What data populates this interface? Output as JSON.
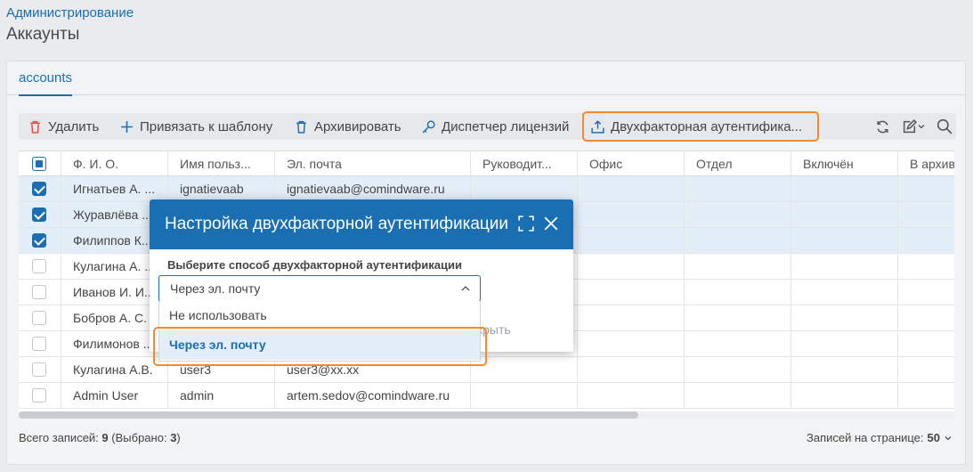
{
  "page": {
    "breadcrumb": "Администрирование",
    "title": "Аккаунты"
  },
  "tabs": [
    {
      "label": "accounts"
    }
  ],
  "toolbar": {
    "delete": "Удалить",
    "bind_template": "Привязать к шаблону",
    "archive": "Архивировать",
    "license_manager": "Диспетчер лицензий",
    "two_factor": "Двухфакторная аутентифика..."
  },
  "table": {
    "columns": [
      "Ф. И. О.",
      "Имя польз...",
      "Эл. почта",
      "Руководит...",
      "Офис",
      "Отдел",
      "Включён",
      "В архив"
    ],
    "rows": [
      {
        "name": "Игнатьев А. ...",
        "login": "ignatievaab",
        "email": "ignatievaab@comindware.ru",
        "selected": true
      },
      {
        "name": "Журавлёва ...",
        "login": "",
        "email": "",
        "selected": true
      },
      {
        "name": "Филиппов К...",
        "login": "",
        "email": "",
        "selected": true
      },
      {
        "name": "Кулагина А. ...",
        "login": "",
        "email": "",
        "selected": false
      },
      {
        "name": "Иванов И. И...",
        "login": "",
        "email": "",
        "selected": false
      },
      {
        "name": "Бобров А. С.",
        "login": "",
        "email": "",
        "selected": false
      },
      {
        "name": "Филимонов ...",
        "login": "",
        "email": "",
        "selected": false
      },
      {
        "name": "Кулагина А.В.",
        "login": "user3",
        "email": "user3@xx.xx",
        "selected": false
      },
      {
        "name": "Admin User",
        "login": "admin",
        "email": "artem.sedov@comindware.ru",
        "selected": false
      }
    ]
  },
  "footer": {
    "total_label": "Всего записей:",
    "total": "9",
    "selected_label": "(Выбрано:",
    "selected": "3",
    "selected_close": ")",
    "per_page_label": "Записей на странице:",
    "per_page": "50"
  },
  "modal": {
    "title": "Настройка двухфакторной аутентификации",
    "label": "Выберите способ двухфакторной аутентификации",
    "selected_value": "Через эл. почту",
    "options": [
      "Не использовать",
      "Через эл. почту"
    ],
    "partially_hidden_button": "крыть"
  },
  "colors": {
    "accent": "#1a6fb3",
    "highlight": "#f28b2e",
    "delete_icon": "#d9534f"
  }
}
